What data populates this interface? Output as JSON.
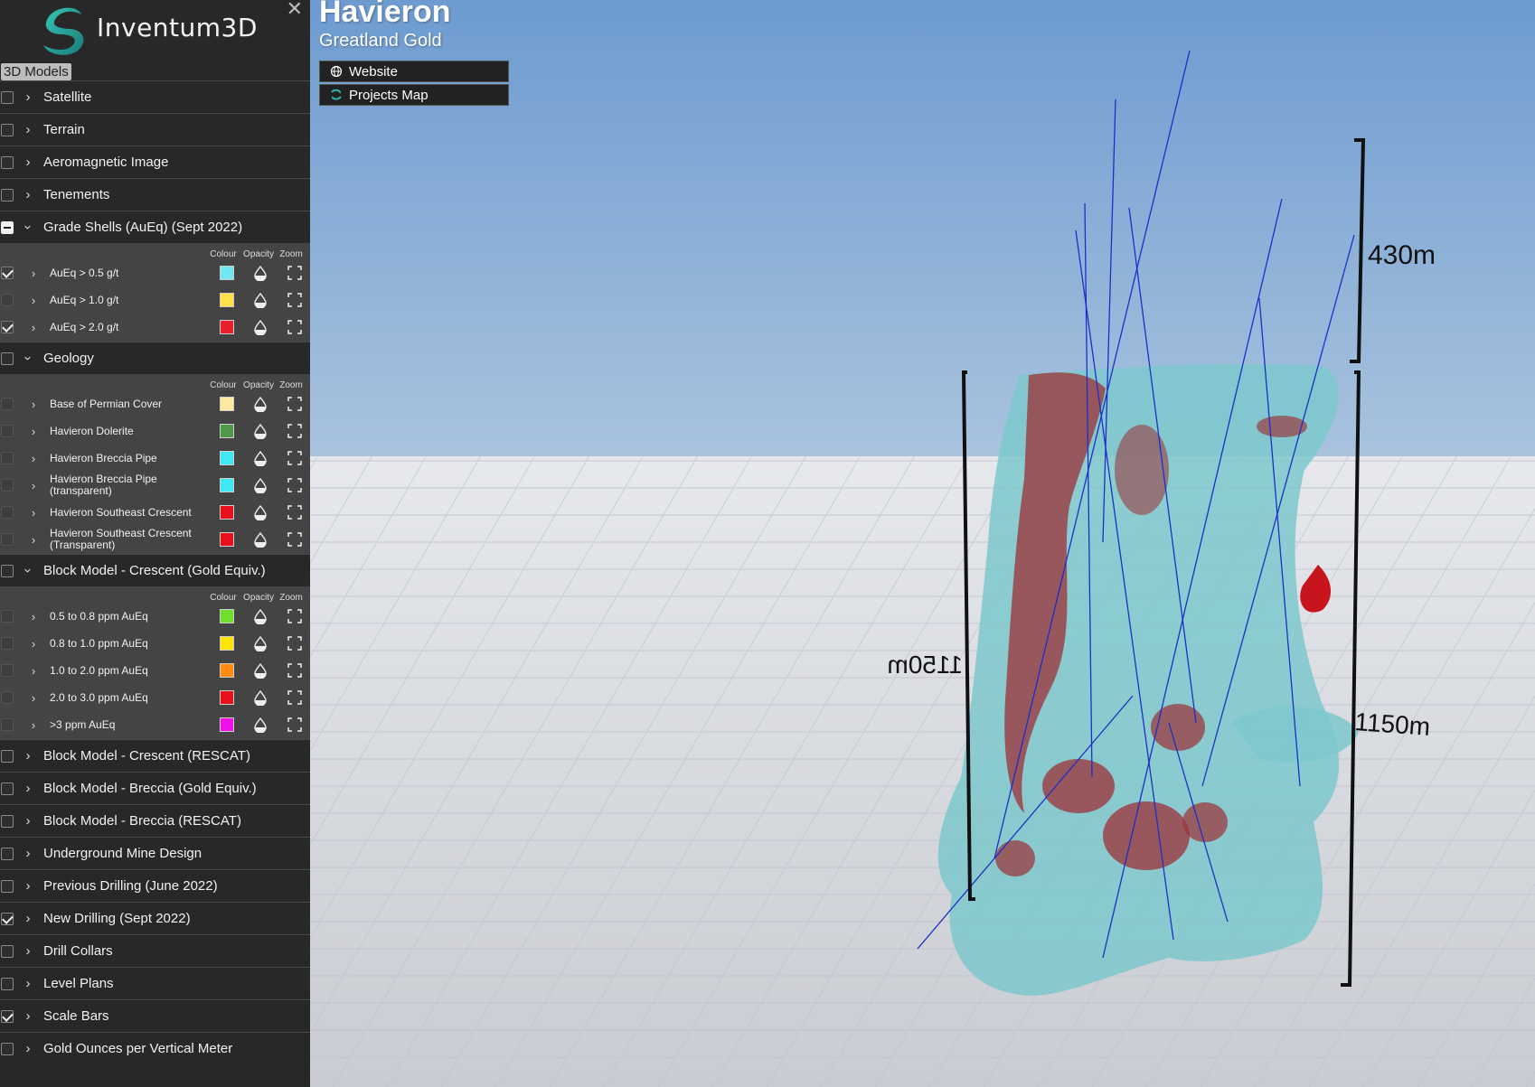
{
  "app": {
    "logo_text": "Inventum3D",
    "close_glyph": "✕",
    "tab_label": "3D Models"
  },
  "project": {
    "title": "Havieron",
    "subtitle": "Greatland Gold",
    "links": [
      {
        "label": "Website",
        "icon": "globe-icon"
      },
      {
        "label": "Projects Map",
        "icon": "inventum-logo-icon"
      }
    ]
  },
  "columns": {
    "colour": "Colour",
    "opacity": "Opacity",
    "zoom": "Zoom"
  },
  "layers": [
    {
      "label": "Satellite",
      "checked": false,
      "expanded": false
    },
    {
      "label": "Terrain",
      "checked": false,
      "expanded": false
    },
    {
      "label": "Aeromagnetic Image",
      "checked": false,
      "expanded": false
    },
    {
      "label": "Tenements",
      "checked": false,
      "expanded": false
    },
    {
      "label": "Grade Shells (AuEq) (Sept 2022)",
      "checked": "partial",
      "expanded": true,
      "children": [
        {
          "label": "AuEq > 0.5 g/t",
          "checked": true,
          "colour": "#6fe6f0"
        },
        {
          "label": "AuEq > 1.0 g/t",
          "checked": false,
          "colour": "#ffe24a"
        },
        {
          "label": "AuEq > 2.0 g/t",
          "checked": true,
          "colour": "#e8202a"
        }
      ]
    },
    {
      "label": "Geology",
      "checked": false,
      "expanded": true,
      "children": [
        {
          "label": "Base of Permian Cover",
          "checked": false,
          "colour": "#ffe9a0"
        },
        {
          "label": "Havieron Dolerite",
          "checked": false,
          "colour": "#4f9a4a"
        },
        {
          "label": "Havieron Breccia Pipe",
          "checked": false,
          "colour": "#3ee9f2"
        },
        {
          "label": "Havieron Breccia Pipe (transparent)",
          "checked": false,
          "colour": "#3ee9f2"
        },
        {
          "label": "Havieron Southeast Crescent",
          "checked": false,
          "colour": "#e8101c"
        },
        {
          "label": "Havieron Southeast Crescent (Transparent)",
          "checked": false,
          "colour": "#e8101c"
        }
      ]
    },
    {
      "label": "Block Model - Crescent (Gold Equiv.)",
      "checked": false,
      "expanded": true,
      "children": [
        {
          "label": "0.5 to 0.8 ppm AuEq",
          "checked": false,
          "colour": "#6ee02a"
        },
        {
          "label": "0.8 to 1.0 ppm AuEq",
          "checked": false,
          "colour": "#ffe600"
        },
        {
          "label": "1.0 to 2.0 ppm AuEq",
          "checked": false,
          "colour": "#ff8c10"
        },
        {
          "label": "2.0 to 3.0 ppm AuEq",
          "checked": false,
          "colour": "#e8101c"
        },
        {
          "label": ">3 ppm AuEq",
          "checked": false,
          "colour": "#f010e8"
        }
      ]
    },
    {
      "label": "Block Model - Crescent (RESCAT)",
      "checked": false,
      "expanded": false
    },
    {
      "label": "Block Model - Breccia (Gold Equiv.)",
      "checked": false,
      "expanded": false
    },
    {
      "label": "Block Model - Breccia (RESCAT)",
      "checked": false,
      "expanded": false
    },
    {
      "label": "Underground Mine Design",
      "checked": false,
      "expanded": false
    },
    {
      "label": "Previous Drilling (June 2022)",
      "checked": false,
      "expanded": false
    },
    {
      "label": "New Drilling (Sept 2022)",
      "checked": true,
      "expanded": false
    },
    {
      "label": "Drill Collars",
      "checked": false,
      "expanded": false
    },
    {
      "label": "Level Plans",
      "checked": false,
      "expanded": false
    },
    {
      "label": "Scale Bars",
      "checked": true,
      "expanded": false
    },
    {
      "label": "Gold Ounces per Vertical Meter",
      "checked": false,
      "expanded": false
    }
  ],
  "scene": {
    "scale_labels": {
      "top_right": "430m",
      "right": "1150m",
      "left_mirrored": "1150m"
    },
    "colors": {
      "sky": "#7fa8d6",
      "shell": "#7cc8cc",
      "high_grade": "#9a3a3e",
      "drill": "#1c2fc8",
      "marker": "#c8141c"
    }
  }
}
